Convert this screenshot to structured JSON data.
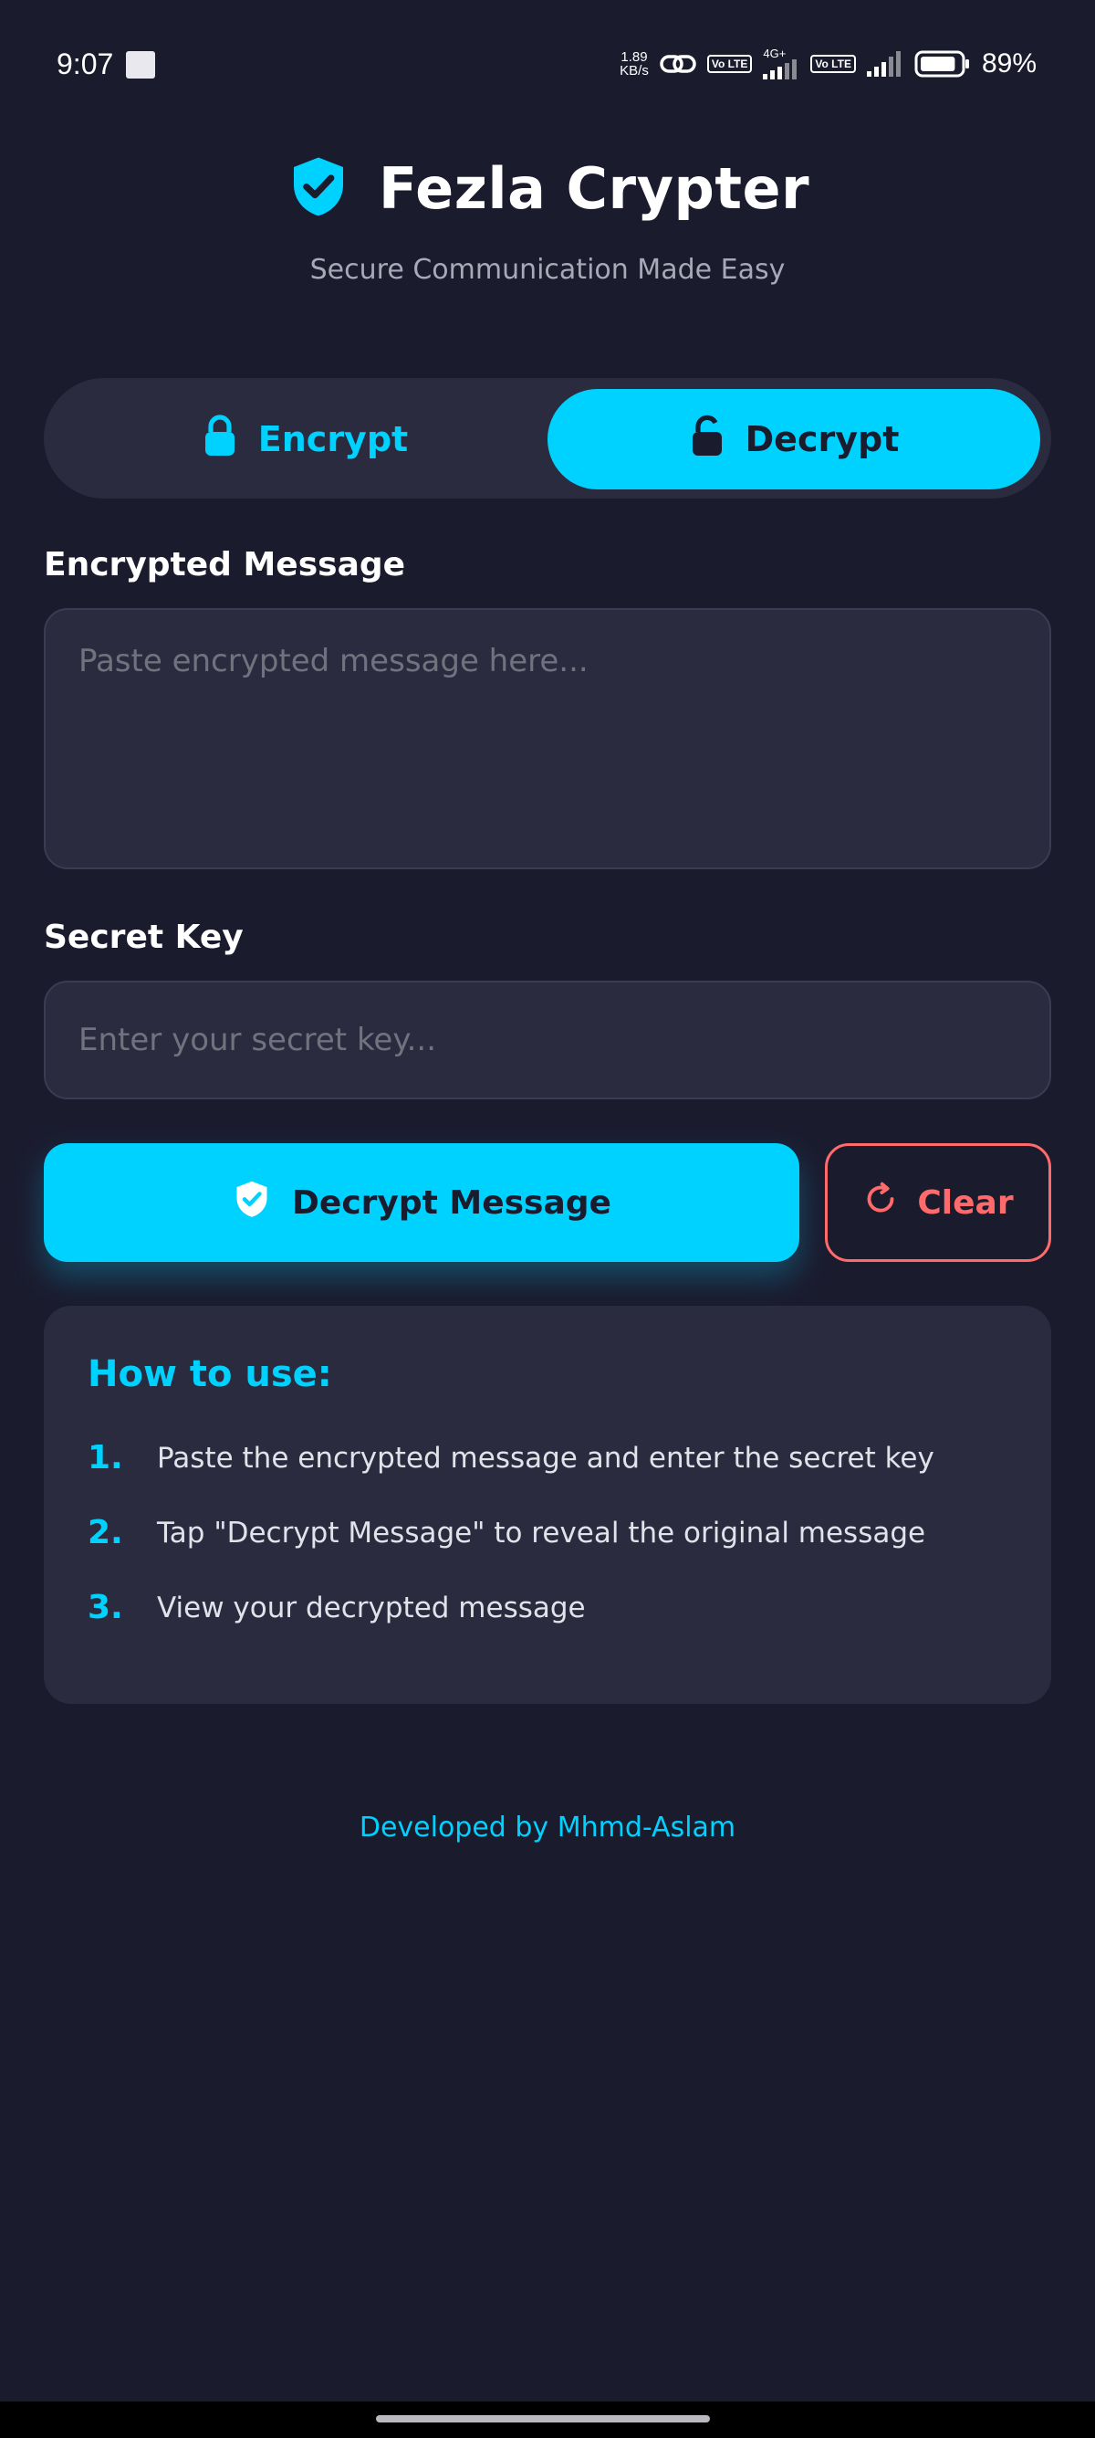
{
  "status_bar": {
    "time": "9:07",
    "net_speed_value": "1.89",
    "net_speed_unit": "KB/s",
    "lte1": "Vo LTE",
    "network_type": "4G+",
    "lte2": "Vo LTE",
    "battery_percent": "89%",
    "battery_level": 0.89
  },
  "header": {
    "title": "Fezla Crypter",
    "subtitle": "Secure Communication Made Easy"
  },
  "mode_toggle": {
    "encrypt_label": "Encrypt",
    "decrypt_label": "Decrypt",
    "active": "Decrypt"
  },
  "form": {
    "message_label": "Encrypted Message",
    "message_placeholder": "Paste encrypted message here...",
    "message_value": "",
    "key_label": "Secret Key",
    "key_placeholder": "Enter your secret key...",
    "key_value": ""
  },
  "actions": {
    "decrypt_label": "Decrypt Message",
    "clear_label": "Clear"
  },
  "how_to": {
    "title": "How to use:",
    "steps": [
      {
        "num": "1.",
        "text": "Paste the encrypted message and enter the secret key"
      },
      {
        "num": "2.",
        "text": "Tap \"Decrypt Message\" to reveal the original message"
      },
      {
        "num": "3.",
        "text": "View your decrypted message"
      }
    ]
  },
  "footer": {
    "credit": "Developed by Mhmd-Aslam"
  },
  "colors": {
    "background": "#1b1b2e",
    "card": "#2a2b3e",
    "accent": "#00d2ff",
    "danger": "#ff6b6b"
  },
  "icons": {
    "logo": "shield-check-icon",
    "encrypt": "lock-closed-icon",
    "decrypt": "lock-open-icon",
    "decrypt_button": "shield-check-icon",
    "clear": "refresh-icon"
  }
}
